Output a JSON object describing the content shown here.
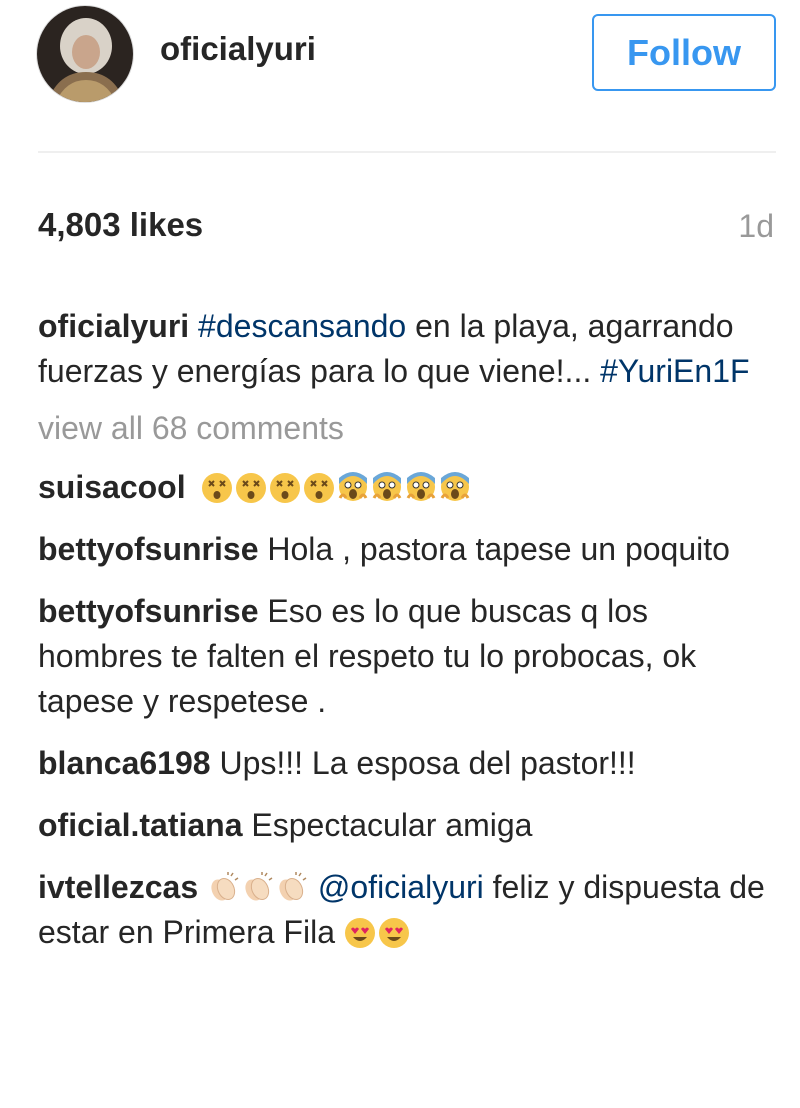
{
  "post": {
    "username": "oficialyuri",
    "follow_label": "Follow",
    "likes": "4,803 likes",
    "time": "1d",
    "caption": {
      "user": "oficialyuri",
      "tag1": "#descansando",
      "text1": " en la playa, agarrando fuerzas y energías para lo que viene!... ",
      "tag2": "#YuriEn1F"
    },
    "view_all": "view all 68 comments",
    "comments": [
      {
        "user": "suisacool",
        "text": ""
      },
      {
        "user": "bettyofsunrise",
        "text": " Hola , pastora tapese un poquito"
      },
      {
        "user": "bettyofsunrise",
        "text": " Eso es lo que buscas q los hombres te falten el respeto tu lo probocas, ok tapese y respetese ."
      },
      {
        "user": "blanca6198",
        "text": " Ups!!! La esposa del pastor!!!"
      },
      {
        "user": "oficial.tatiana",
        "text": " Espectacular amiga"
      },
      {
        "user": "ivtellezcas",
        "mention": "@oficialyuri",
        "text": " feliz y dispuesta de estar en Primera Fila "
      }
    ],
    "icons": {
      "dizzy": "dizzy-face-emoji",
      "scream": "screaming-face-emoji",
      "clap": "clapping-hands-emoji",
      "heart_eyes": "heart-eyes-emoji"
    }
  }
}
